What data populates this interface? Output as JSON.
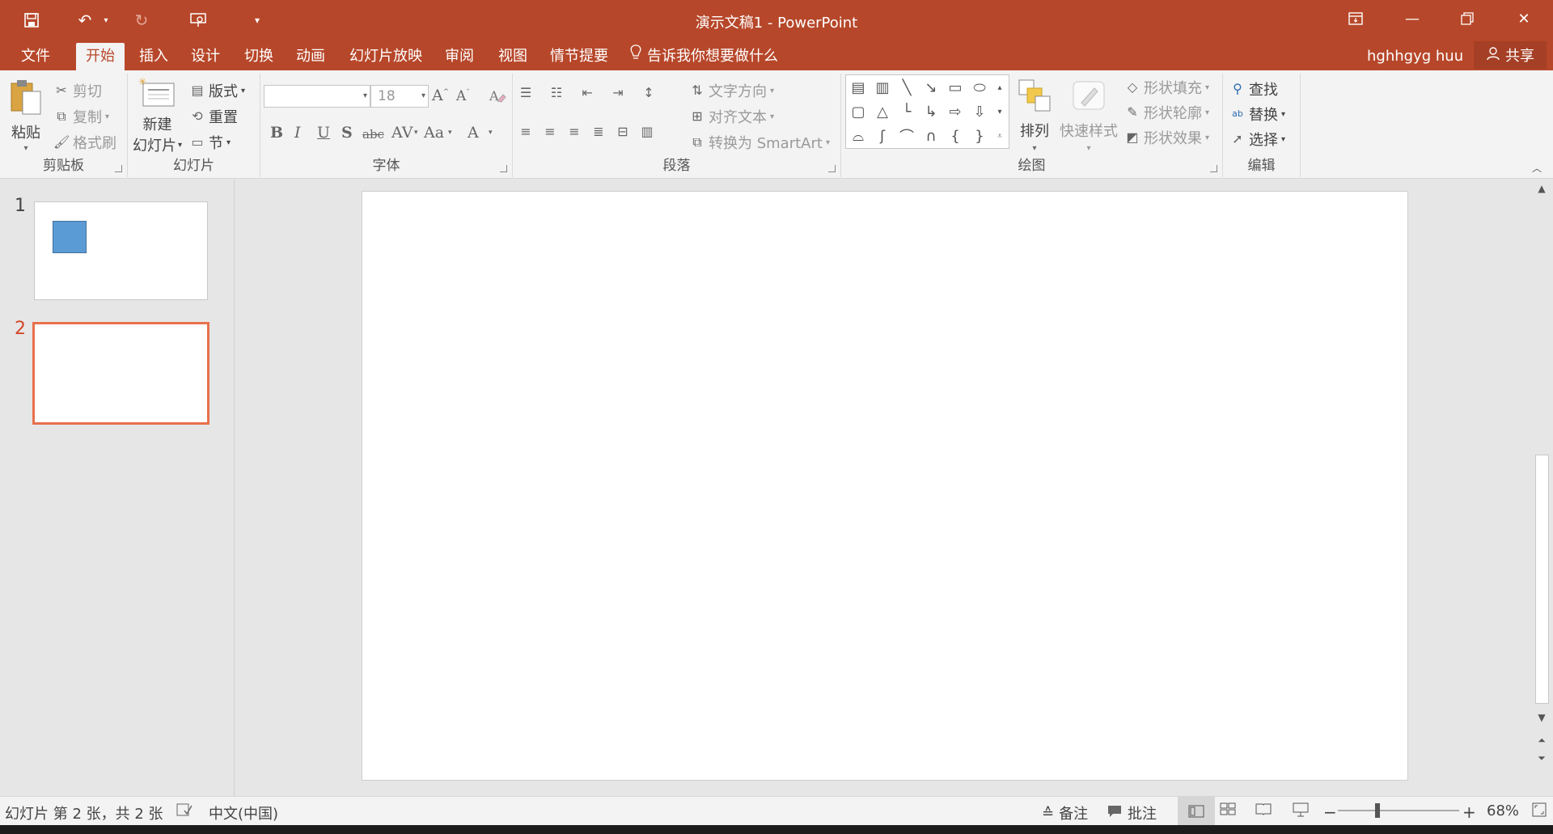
{
  "window": {
    "title": "演示文稿1 - PowerPoint",
    "accent": "#b7472a"
  },
  "qat": {
    "icons": [
      "save-icon",
      "undo-icon",
      "redo-icon",
      "presenter-icon",
      "customize-icon"
    ]
  },
  "tabs": [
    "文件",
    "开始",
    "插入",
    "设计",
    "切换",
    "动画",
    "幻灯片放映",
    "审阅",
    "视图",
    "情节提要"
  ],
  "active_tab": "开始",
  "tell_me": "告诉我你想要做什么",
  "user": "hghhgyg huu",
  "share": "共享",
  "ribbon": {
    "clipboard": {
      "paste": "粘贴",
      "cut": "剪切",
      "copy": "复制",
      "format_painter": "格式刷",
      "label": "剪贴板"
    },
    "slides": {
      "new_slide_1": "新建",
      "new_slide_2": "幻灯片",
      "layout": "版式",
      "reset": "重置",
      "section": "节",
      "label": "幻灯片"
    },
    "font": {
      "font_name": "",
      "font_size": "18",
      "bold": "B",
      "italic": "I",
      "underline": "U",
      "shadow": "S",
      "strike": "abc",
      "spacing": "AV",
      "case": "Aa",
      "color": "A",
      "label": "字体"
    },
    "paragraph": {
      "text_direction": "文字方向",
      "align_text": "对齐文本",
      "smartart": "转换为 SmartArt",
      "label": "段落"
    },
    "drawing": {
      "arrange": "排列",
      "quick_styles": "快速样式",
      "shape_fill": "形状填充",
      "shape_outline": "形状轮廓",
      "shape_effects": "形状效果",
      "label": "绘图"
    },
    "editing": {
      "find": "查找",
      "replace": "替换",
      "select": "选择",
      "label": "编辑"
    }
  },
  "slides": [
    {
      "number": "1",
      "has_shape": true,
      "shape_color": "#5b9bd5"
    },
    {
      "number": "2",
      "selected": true
    }
  ],
  "status": {
    "slide_info": "幻灯片 第 2 张，共 2 张",
    "language": "中文(中国)",
    "notes": "备注",
    "comments": "批注",
    "zoom": "68%"
  }
}
